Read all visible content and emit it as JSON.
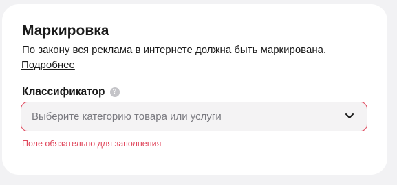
{
  "section": {
    "title": "Маркировка",
    "description": "По закону вся реклама в интернете должна быть маркирована.",
    "more_link": "Подробнее"
  },
  "classifier": {
    "label": "Классификатор",
    "help_icon": "?",
    "placeholder": "Выберите категорию товара или услуги",
    "error": "Поле обязательно для заполнения"
  },
  "colors": {
    "error": "#e0475c",
    "text": "#1a1a1a",
    "placeholder": "#7a7a80",
    "page_bg": "#f2f2f4",
    "field_bg": "#f4f3f4"
  },
  "icons": {
    "help": "question-circle-icon",
    "dropdown": "chevron-down-icon"
  }
}
